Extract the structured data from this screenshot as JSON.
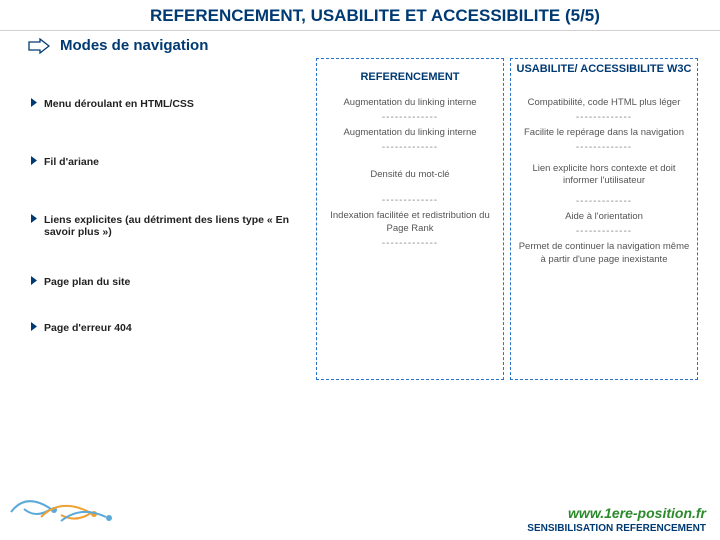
{
  "title": "REFERENCEMENT, USABILITE ET ACCESSIBILITE (5/5)",
  "subtitle": "Modes de navigation",
  "left": {
    "items": [
      "Menu déroulant en HTML/CSS",
      "Fil d'ariane",
      "Liens explicites (au détriment des liens type « En savoir plus »)",
      "Page plan du site",
      "Page d'erreur 404"
    ]
  },
  "columns": {
    "ref": {
      "header": "REFERENCEMENT",
      "cells": [
        "Augmentation du linking interne",
        "Augmentation du linking interne",
        "Densité du mot-clé",
        "Indexation facilitée et redistribution du Page Rank"
      ]
    },
    "usab": {
      "header": "USABILITE/ ACCESSIBILITE W3C",
      "cells": [
        "Compatibilité, code HTML plus léger",
        "Facilite le repérage dans la navigation",
        "Lien explicite hors contexte et doit informer l'utilisateur",
        "Aide à l'orientation",
        "Permet de continuer la navigation même à partir d'une page inexistante"
      ]
    }
  },
  "separator": "-------------",
  "footer": {
    "link": "www.1ere-position.fr",
    "sub": "SENSIBILISATION REFERENCEMENT"
  }
}
